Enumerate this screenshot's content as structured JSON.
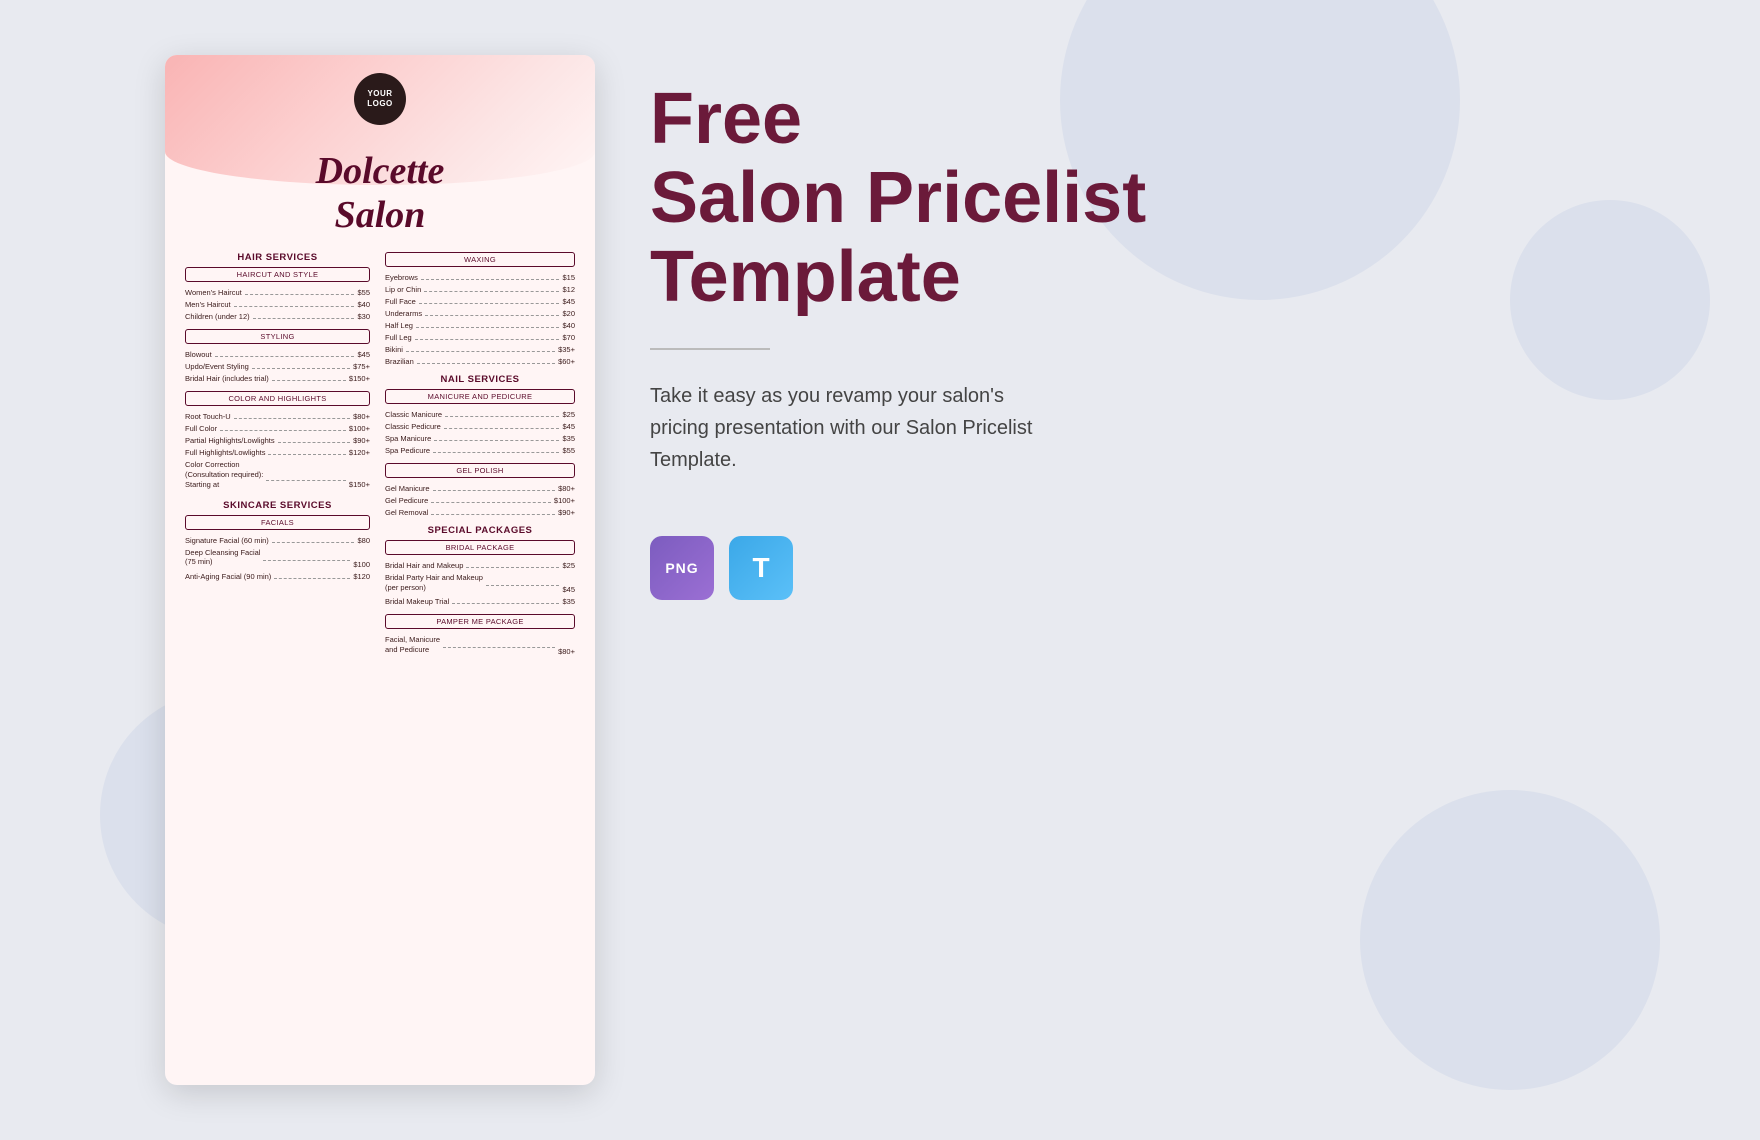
{
  "background": "#e8eaf0",
  "document": {
    "logo_text": "YOUR\nLOGO",
    "salon_name": "Dolcette\nSalon",
    "left_column": {
      "hair_services": {
        "section_title": "HAIR SERVICES",
        "subsections": [
          {
            "label": "HAIRCUT AND STYLE",
            "items": [
              {
                "name": "Women's Haircut",
                "price": "$55"
              },
              {
                "name": "Men's Haircut",
                "price": "$40"
              },
              {
                "name": "Children (under 12)",
                "price": "$30"
              }
            ]
          },
          {
            "label": "STYLING",
            "items": [
              {
                "name": "Blowout",
                "price": "$45"
              },
              {
                "name": "Updo/Event Styling",
                "price": "$75+"
              },
              {
                "name": "Bridal Hair (includes trial)",
                "price": "$150+"
              }
            ]
          },
          {
            "label": "COLOR AND HIGHLIGHTS",
            "items": [
              {
                "name": "Root Touch-U",
                "price": "$80+"
              },
              {
                "name": "Full Color",
                "price": "$100+"
              },
              {
                "name": "Partial Highlights/Lowlights",
                "price": "$90+"
              },
              {
                "name": "Full Highlights/Lowlights",
                "price": "$120+"
              },
              {
                "name": "Color Correction\n(Consultation required):\nStarting at",
                "price": "$150+",
                "multiline": true
              }
            ]
          }
        ]
      },
      "skincare_services": {
        "section_title": "SKINCARE SERVICES",
        "subsections": [
          {
            "label": "FACIALS",
            "items": [
              {
                "name": "Signature Facial (60 min)",
                "price": "$80"
              },
              {
                "name": "Deep Cleansing Facial\n(75 min)",
                "price": "$100",
                "multiline": true
              },
              {
                "name": "Anti-Aging Facial (90 min)",
                "price": "$120"
              }
            ]
          }
        ]
      }
    },
    "right_column": {
      "waxing": {
        "section_title": "WAXING",
        "items": [
          {
            "name": "Eyebrows",
            "price": "$15"
          },
          {
            "name": "Lip or Chin",
            "price": "$12"
          },
          {
            "name": "Full Face",
            "price": "$45"
          },
          {
            "name": "Underarms",
            "price": "$20"
          },
          {
            "name": "Half Leg",
            "price": "$40"
          },
          {
            "name": "Full Leg",
            "price": "$70"
          },
          {
            "name": "Bikini",
            "price": "$35+"
          },
          {
            "name": "Brazilian",
            "price": "$60+"
          }
        ]
      },
      "nail_services": {
        "section_title": "NAIL SERVICES",
        "subsections": [
          {
            "label": "MANICURE AND PEDICURE",
            "items": [
              {
                "name": "Classic Manicure",
                "price": "$25"
              },
              {
                "name": "Classic Pedicure",
                "price": "$45"
              },
              {
                "name": "Spa Manicure",
                "price": "$35"
              },
              {
                "name": "Spa Pedicure",
                "price": "$55"
              }
            ]
          },
          {
            "label": "GEL POLISH",
            "items": [
              {
                "name": "Gel Manicure",
                "price": "$80+"
              },
              {
                "name": "Gel Pedicure",
                "price": "$100+"
              },
              {
                "name": "Gel Removal",
                "price": "$90+"
              }
            ]
          }
        ]
      },
      "special_packages": {
        "section_title": "SPECIAL PACKAGES",
        "subsections": [
          {
            "label": "BRIDAL PACKAGE",
            "items": [
              {
                "name": "Bridal Hair and Makeup",
                "price": "$25"
              },
              {
                "name": "Bridal Party Hair and Makeup\n(per person)",
                "price": "$45",
                "multiline": true
              },
              {
                "name": "Bridal Makeup Trial",
                "price": "$35"
              }
            ]
          },
          {
            "label": "PAMPER ME PACKAGE",
            "items": [
              {
                "name": "Facial, Manicure\nand Pedicure",
                "price": "$80+",
                "multiline": true
              }
            ]
          }
        ]
      }
    }
  },
  "marketing": {
    "title": "Free\nSalon Pricelist\nTemplate",
    "description": "Take it easy as you revamp your salon's\npricing presentation with our Salon Pricelist\nTemplate.",
    "badges": [
      {
        "type": "png",
        "label": "PNG"
      },
      {
        "type": "t",
        "label": "T"
      }
    ]
  }
}
